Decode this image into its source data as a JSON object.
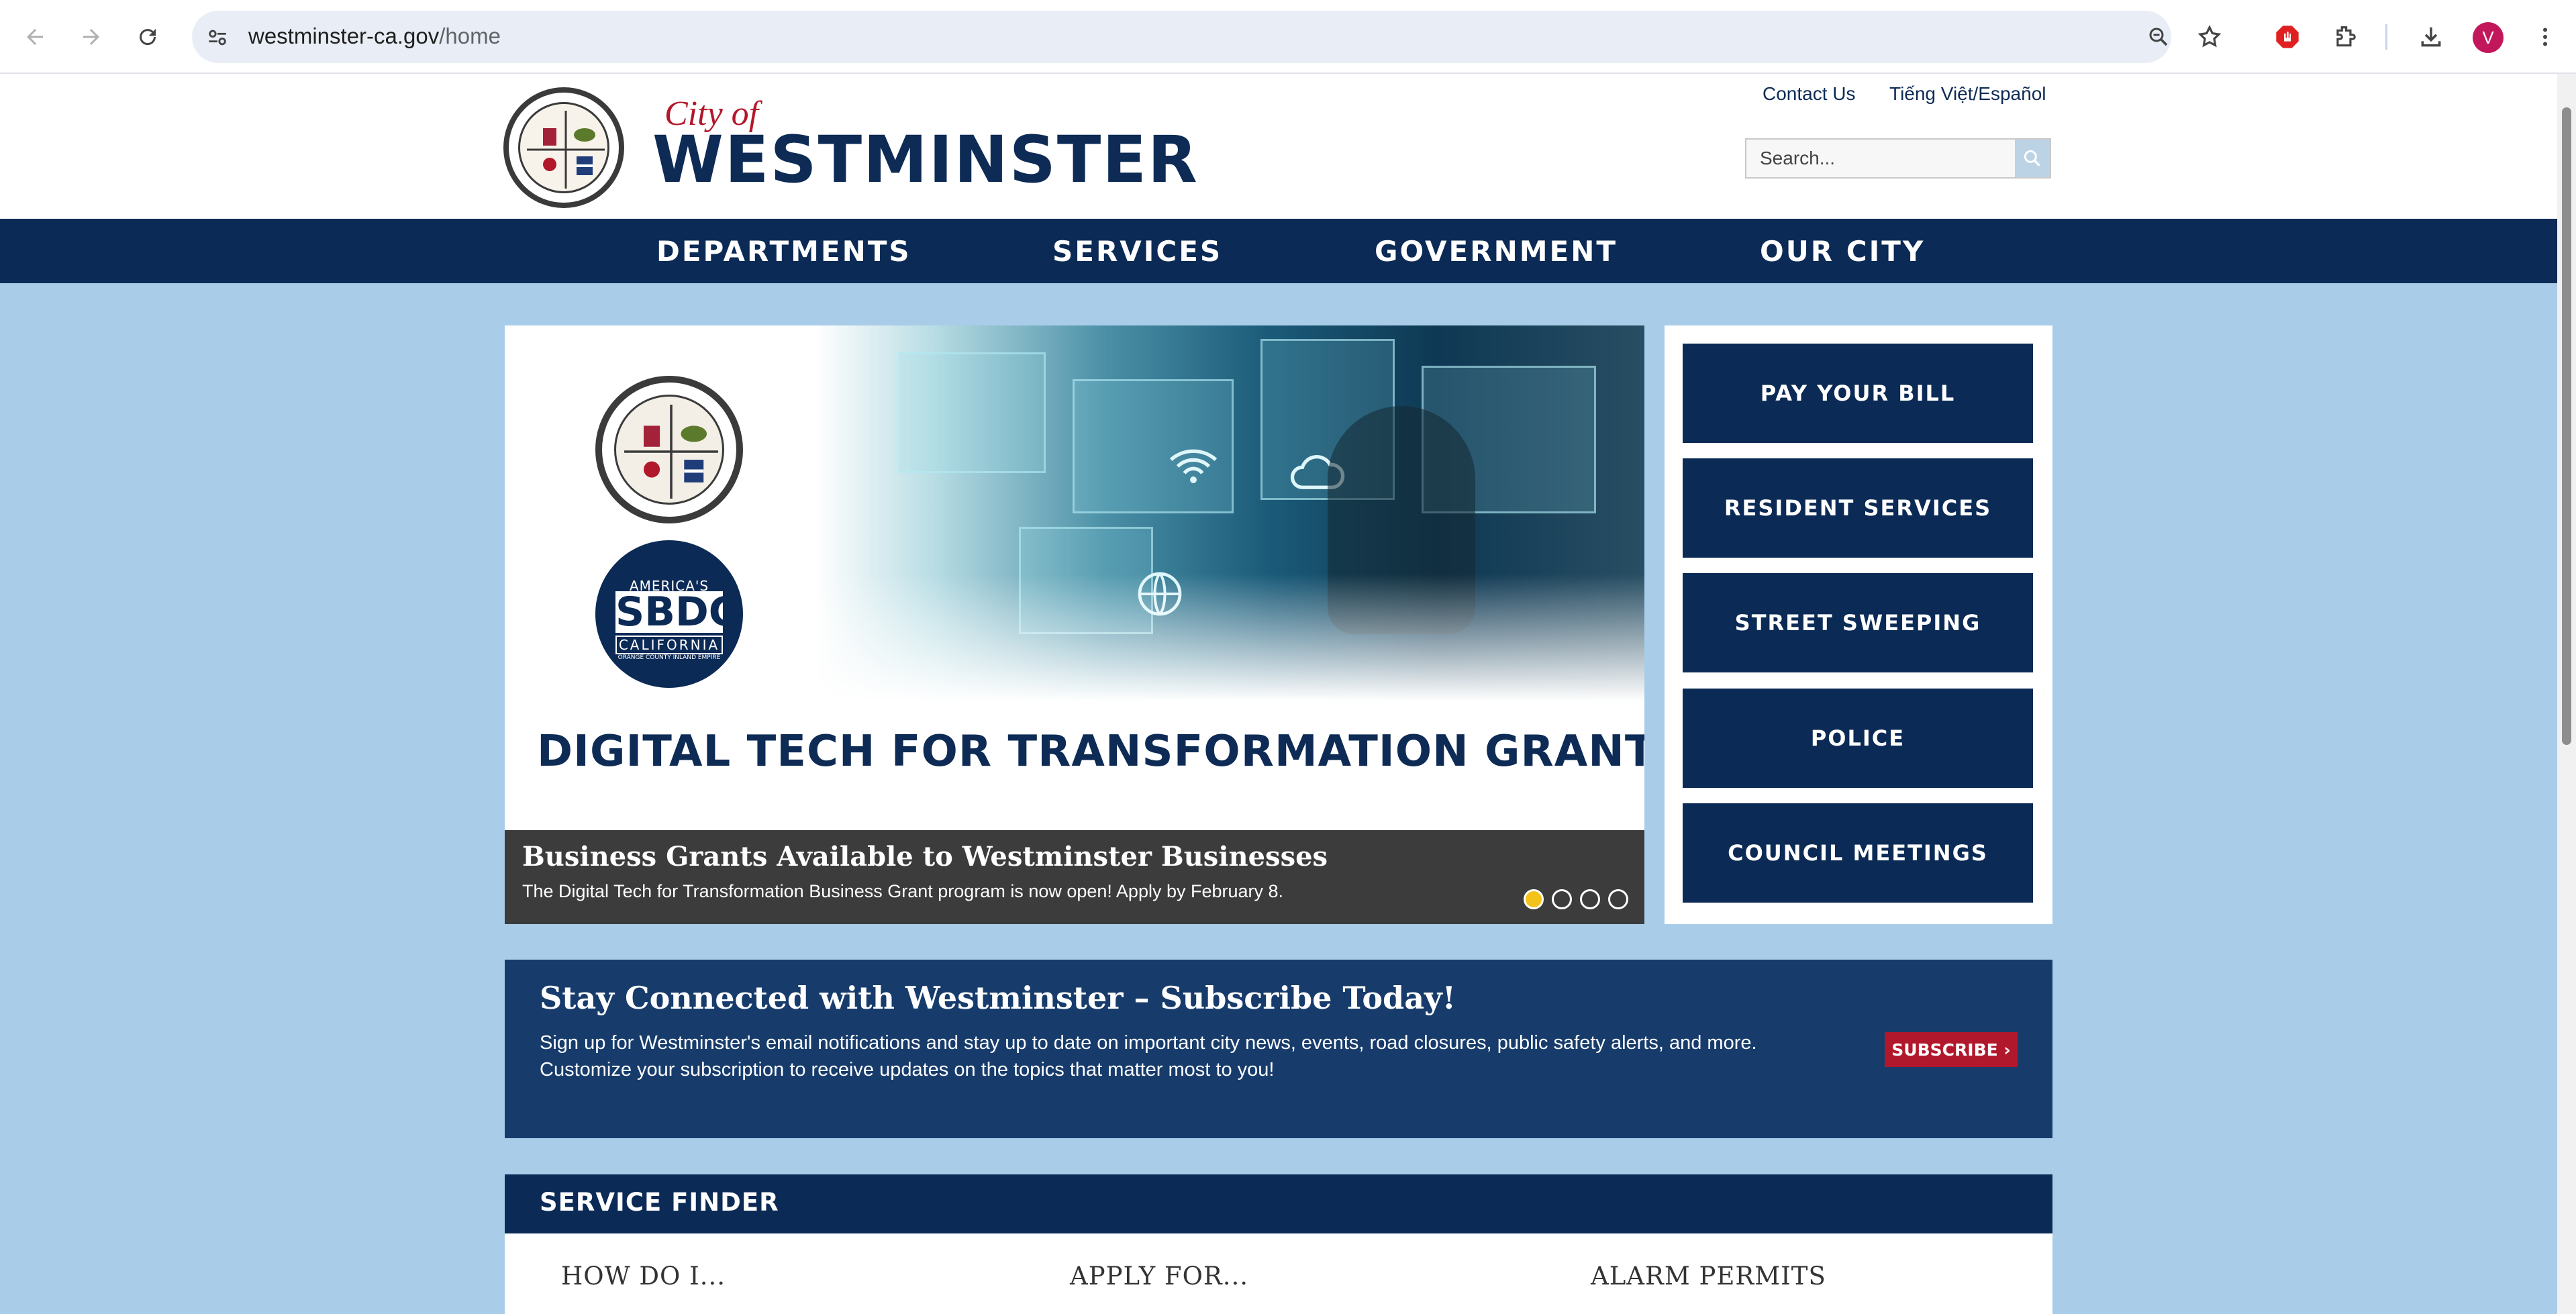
{
  "browser": {
    "url_host": "westminster-ca.gov",
    "url_path": "/home",
    "profile_initial": "V"
  },
  "header": {
    "brand_city": "City of",
    "brand_name": "WESTMINSTER",
    "util_links": [
      "Contact Us",
      "Tiếng Việt/Español"
    ],
    "search_placeholder": "Search..."
  },
  "nav": {
    "items": [
      "DEPARTMENTS",
      "SERVICES",
      "GOVERNMENT",
      "OUR CITY"
    ]
  },
  "hero": {
    "headline": "DIGITAL TECH FOR TRANSFORMATION GRANT",
    "sbdc_top": "AMERICA'S",
    "sbdc_mid": "SBDC",
    "sbdc_bottom": "CALIFORNIA",
    "sbdc_sub": "ORANGE COUNTY INLAND EMPIRE",
    "caption_title": "Business Grants Available to Westminster Businesses",
    "caption_desc": "The Digital Tech for Transformation Business Grant program is now open! Apply by February 8.",
    "slide_count": 4,
    "active_slide": 1
  },
  "quick_links": [
    "PAY YOUR BILL",
    "RESIDENT SERVICES",
    "STREET SWEEPING",
    "POLICE",
    "COUNCIL MEETINGS"
  ],
  "subscribe": {
    "title": "Stay Connected with Westminster – Subscribe Today!",
    "body": "Sign up for Westminster's email notifications and stay up to date on important city news, events, road closures, public safety alerts, and more. Customize your subscription to receive updates on the topics that matter most to you!",
    "button": "SUBSCRIBE ›"
  },
  "service_finder": {
    "title": "SERVICE FINDER",
    "columns": [
      "HOW DO I...",
      "APPLY FOR...",
      "ALARM PERMITS"
    ]
  },
  "colors": {
    "navy": "#0b2a55",
    "brand_red": "#b2182b",
    "page_bg": "#a9cde9",
    "active_dot": "#f3c21b"
  }
}
